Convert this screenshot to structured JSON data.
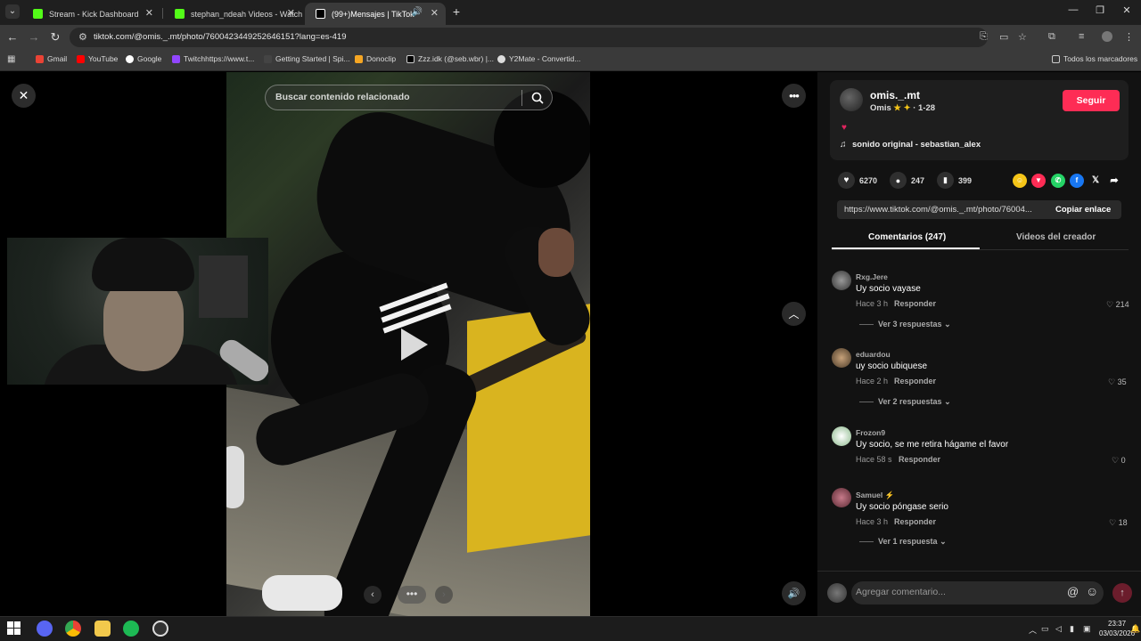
{
  "browser": {
    "tabs": [
      {
        "title": "Stream - Kick Dashboard"
      },
      {
        "title": "stephan_ndeah Videos - Watch"
      },
      {
        "title": "(99+)Mensajes | TikTok"
      }
    ],
    "url": "tiktok.com/@omis._.mt/photo/7600423449252646151?lang=es-419",
    "bookmarks": [
      {
        "label": "Gmail"
      },
      {
        "label": "YouTube"
      },
      {
        "label": "Google"
      },
      {
        "label": "Twitchhttps://www.t..."
      },
      {
        "label": "Getting Started | Spi..."
      },
      {
        "label": "Donoclip"
      },
      {
        "label": "Zzz.idk (@seb.wbr) |..."
      },
      {
        "label": "Y2Mate - Convertid..."
      }
    ],
    "all_bookmarks": "Todos los marcadores"
  },
  "media": {
    "search_placeholder": "Buscar contenido relacionado"
  },
  "post": {
    "username": "omis._.mt",
    "nickname": "Omis",
    "date": "· 1-28",
    "follow_label": "Seguir",
    "sound": "sonido original - sebastian_alex",
    "likes": "6270",
    "comments": "247",
    "saves": "399",
    "link": "https://www.tiktok.com/@omis._.mt/photo/76004...",
    "copy_label": "Copiar enlace"
  },
  "tabs": {
    "comments": "Comentarios (247)",
    "videos": "Videos del creador"
  },
  "comments": [
    {
      "user": "Rxg.Jere",
      "text": "Uy socio vayase",
      "time": "Hace 3 h",
      "reply": "Responder",
      "likes": "214",
      "more": "Ver 3 respuestas"
    },
    {
      "user": "eduardou",
      "text": "uy socio ubiquese",
      "time": "Hace 2 h",
      "reply": "Responder",
      "likes": "35",
      "more": "Ver 2 respuestas"
    },
    {
      "user": "Frozon9",
      "text": "Uy socio, se me retira hágame el favor",
      "time": "Hace 58 s",
      "reply": "Responder",
      "likes": "0"
    },
    {
      "user": "Samuel",
      "text": "Uy socio póngase serio",
      "time": "Hace 3 h",
      "reply": "Responder",
      "likes": "18",
      "more": "Ver 1 respuesta"
    }
  ],
  "comment_input": {
    "placeholder": "Agregar comentario..."
  },
  "taskbar": {
    "time": "23:37",
    "date": "03/03/2026"
  },
  "colors": {
    "follow": "#fe2c55",
    "panel": "#121212",
    "chrome": "#3a3a3a"
  }
}
